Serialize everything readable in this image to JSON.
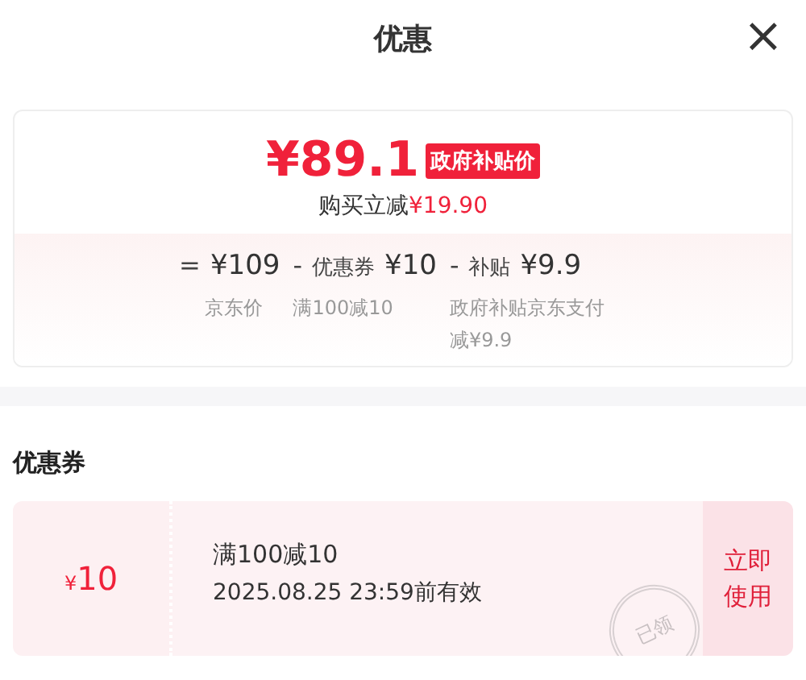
{
  "header": {
    "title": "优惠",
    "close": "×"
  },
  "price": {
    "amount": "¥89.1",
    "tag": "政府补贴价",
    "saving_label": "购买立减",
    "saving_amount": "¥19.90"
  },
  "breakdown": [
    {
      "op": "=",
      "amount": "¥109",
      "note": "京东价"
    },
    {
      "op": "-",
      "prefix": "优惠券",
      "amount": "¥10",
      "note": "满100减10"
    },
    {
      "op": "-",
      "prefix": "补贴",
      "amount": "¥9.9",
      "note": "政府补贴京东支付减¥9.9"
    }
  ],
  "coupons_section": {
    "title": "优惠券",
    "coupons": [
      {
        "currency": "¥",
        "value": "10",
        "condition": "满100减10",
        "validity": "2025.08.25 23:59前有效",
        "stamp": "已领",
        "claimed": true,
        "action": "立即使用"
      }
    ]
  }
}
